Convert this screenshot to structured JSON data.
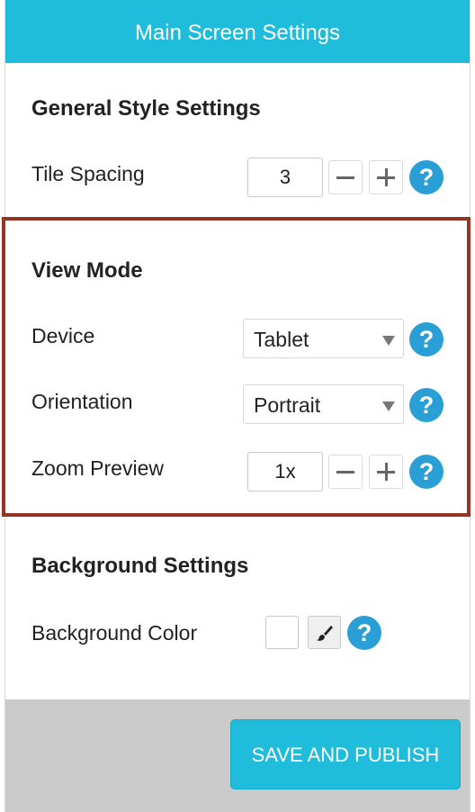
{
  "header": {
    "title": "Main Screen Settings"
  },
  "general": {
    "title": "General Style Settings",
    "tile_spacing": {
      "label": "Tile Spacing",
      "value": "3"
    }
  },
  "view_mode": {
    "title": "View Mode",
    "device": {
      "label": "Device",
      "value": "Tablet"
    },
    "orientation": {
      "label": "Orientation",
      "value": "Portrait"
    },
    "zoom": {
      "label": "Zoom Preview",
      "value": "1x"
    }
  },
  "background": {
    "title": "Background Settings",
    "color": {
      "label": "Background Color",
      "value": "#ffffff"
    }
  },
  "icons": {
    "help": "?",
    "help_icon": "help-icon",
    "minus_icon": "minus-icon",
    "plus_icon": "plus-icon",
    "brush_icon": "paintbrush-icon",
    "caret_icon": "chevron-down-icon"
  },
  "footer": {
    "save_label": "SAVE AND PUBLISH"
  },
  "colors": {
    "accent": "#1fbddb",
    "help": "#2a9fd6",
    "highlight": "#943524",
    "footer_bg": "#cbcbcb"
  }
}
